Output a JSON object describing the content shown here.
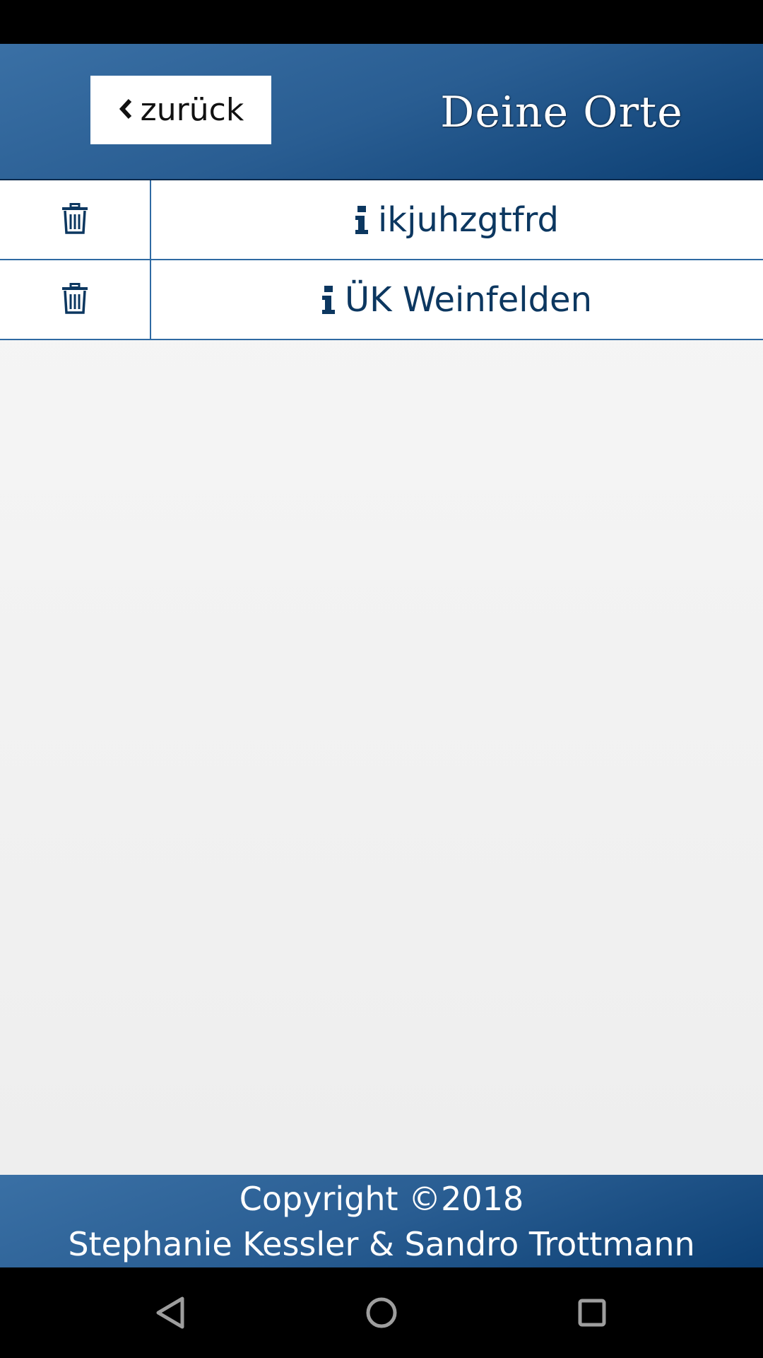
{
  "header": {
    "back_label": "zurück",
    "title": "Deine Orte"
  },
  "places": [
    {
      "name": "ikjuhzgtfrd"
    },
    {
      "name": "ÜK Weinfelden"
    }
  ],
  "footer": {
    "copyright": "Copyright ©2018",
    "authors": "Stephanie Kessler & Sandro Trottmann"
  },
  "colors": {
    "primary": "#295d92",
    "primary_dark": "#0c3f73",
    "text_dark": "#0c3760",
    "background": "#f2f2f2"
  },
  "icons": {
    "back": "chevron-left-icon",
    "delete": "trash-icon",
    "info": "info-icon"
  }
}
